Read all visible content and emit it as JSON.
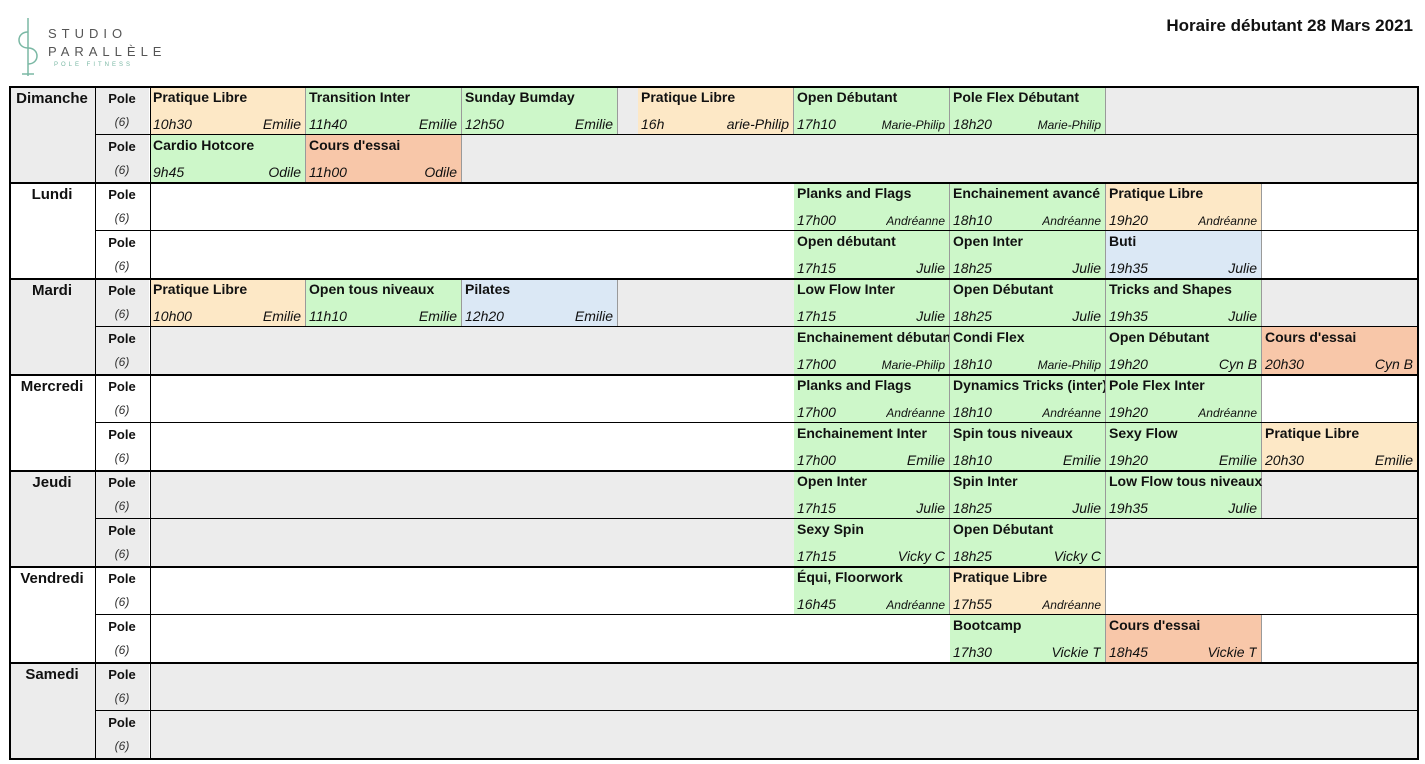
{
  "logo": {
    "line1": "STUDIO",
    "line2": "PARALLÈLE",
    "line3": "POLE FITNESS"
  },
  "title": "Horaire débutant 28 Mars 2021",
  "colors": {
    "green": "#cdf7c9",
    "orange": "#fde8c6",
    "salmon": "#f8c7a9",
    "blue": "#dbe8f5",
    "gray": "#ececec",
    "white": "#ffffff"
  },
  "pole_label": "Pole",
  "capacity": "(6)",
  "days": [
    {
      "name": "Dimanche",
      "rows": [
        {
          "bg": "gray",
          "classes": [
            {
              "col": 0,
              "name": "Pratique Libre",
              "time": "10h30",
              "instructor": "Emilie",
              "color": "orange"
            },
            {
              "col": 1,
              "name": "Transition Inter",
              "time": "11h40",
              "instructor": "Emilie",
              "color": "green"
            },
            {
              "col": 2,
              "name": "Sunday Bumday",
              "time": "12h50",
              "instructor": "Emilie",
              "color": "green"
            },
            {
              "col": 4,
              "name": "Pratique Libre",
              "time": "16h",
              "instructor": "arie-Philip",
              "color": "orange"
            },
            {
              "col": 5,
              "name": "Open Débutant",
              "time": "17h10",
              "instructor": "Marie-Philip",
              "color": "green",
              "small": true
            },
            {
              "col": 6,
              "name": "Pole Flex Débutant",
              "time": "18h20",
              "instructor": "Marie-Philip",
              "color": "green",
              "small": true
            }
          ]
        },
        {
          "bg": "gray",
          "classes": [
            {
              "col": 0,
              "name": "Cardio Hotcore",
              "time": "9h45",
              "instructor": "Odile",
              "color": "green"
            },
            {
              "col": 1,
              "name": "Cours d'essai",
              "time": "11h00",
              "instructor": "Odile",
              "color": "salmon"
            }
          ]
        }
      ]
    },
    {
      "name": "Lundi",
      "rows": [
        {
          "bg": "white",
          "classes": [
            {
              "col": 5,
              "name": "Planks and Flags",
              "time": "17h00",
              "instructor": "Andréanne",
              "color": "green",
              "small": true
            },
            {
              "col": 6,
              "name": "Enchainement avancé",
              "time": "18h10",
              "instructor": "Andréanne",
              "color": "green",
              "small": true
            },
            {
              "col": 7,
              "name": "Pratique Libre",
              "time": "19h20",
              "instructor": "Andréanne",
              "color": "orange",
              "small": true
            }
          ]
        },
        {
          "bg": "white",
          "classes": [
            {
              "col": 5,
              "name": "Open débutant",
              "time": "17h15",
              "instructor": "Julie",
              "color": "green"
            },
            {
              "col": 6,
              "name": "Open Inter",
              "time": "18h25",
              "instructor": "Julie",
              "color": "green"
            },
            {
              "col": 7,
              "name": "Buti",
              "time": "19h35",
              "instructor": "Julie",
              "color": "blue"
            }
          ]
        }
      ]
    },
    {
      "name": "Mardi",
      "rows": [
        {
          "bg": "gray",
          "classes": [
            {
              "col": 0,
              "name": "Pratique Libre",
              "time": "10h00",
              "instructor": "Emilie",
              "color": "orange"
            },
            {
              "col": 1,
              "name": "Open tous niveaux",
              "time": "11h10",
              "instructor": "Emilie",
              "color": "green"
            },
            {
              "col": 2,
              "name": "Pilates",
              "time": "12h20",
              "instructor": "Emilie",
              "color": "blue"
            },
            {
              "col": 5,
              "name": "Low Flow Inter",
              "time": "17h15",
              "instructor": "Julie",
              "color": "green"
            },
            {
              "col": 6,
              "name": "Open Débutant",
              "time": "18h25",
              "instructor": "Julie",
              "color": "green"
            },
            {
              "col": 7,
              "name": "Tricks and Shapes",
              "time": "19h35",
              "instructor": "Julie",
              "color": "green"
            }
          ]
        },
        {
          "bg": "gray",
          "classes": [
            {
              "col": 5,
              "name": "Enchainement débutant",
              "time": "17h00",
              "instructor": "Marie-Philip",
              "color": "green",
              "small": true
            },
            {
              "col": 6,
              "name": "Condi Flex",
              "time": "18h10",
              "instructor": "Marie-Philip",
              "color": "green",
              "small": true
            },
            {
              "col": 7,
              "name": "Open Débutant",
              "time": "19h20",
              "instructor": "Cyn B",
              "color": "green"
            },
            {
              "col": 8,
              "name": "Cours d'essai",
              "time": "20h30",
              "instructor": "Cyn B",
              "color": "salmon"
            }
          ]
        }
      ]
    },
    {
      "name": "Mercredi",
      "rows": [
        {
          "bg": "white",
          "classes": [
            {
              "col": 5,
              "name": "Planks and Flags",
              "time": "17h00",
              "instructor": "Andréanne",
              "color": "green",
              "small": true
            },
            {
              "col": 6,
              "name": "Dynamics Tricks (inter)",
              "time": "18h10",
              "instructor": "Andréanne",
              "color": "green",
              "small": true
            },
            {
              "col": 7,
              "name": "Pole Flex Inter",
              "time": "19h20",
              "instructor": "Andréanne",
              "color": "green",
              "small": true
            }
          ]
        },
        {
          "bg": "white",
          "classes": [
            {
              "col": 5,
              "name": "Enchainement Inter",
              "time": "17h00",
              "instructor": "Emilie",
              "color": "green"
            },
            {
              "col": 6,
              "name": "Spin tous niveaux",
              "time": "18h10",
              "instructor": "Emilie",
              "color": "green"
            },
            {
              "col": 7,
              "name": "Sexy Flow",
              "time": "19h20",
              "instructor": "Emilie",
              "color": "green"
            },
            {
              "col": 8,
              "name": "Pratique Libre",
              "time": "20h30",
              "instructor": "Emilie",
              "color": "orange"
            }
          ]
        }
      ]
    },
    {
      "name": "Jeudi",
      "rows": [
        {
          "bg": "gray",
          "classes": [
            {
              "col": 5,
              "name": "Open Inter",
              "time": "17h15",
              "instructor": "Julie",
              "color": "green"
            },
            {
              "col": 6,
              "name": "Spin Inter",
              "time": "18h25",
              "instructor": "Julie",
              "color": "green"
            },
            {
              "col": 7,
              "name": "Low Flow tous niveaux",
              "time": "19h35",
              "instructor": "Julie",
              "color": "green",
              "overflow": true
            }
          ]
        },
        {
          "bg": "gray",
          "classes": [
            {
              "col": 5,
              "name": "Sexy Spin",
              "time": "17h15",
              "instructor": "Vicky C",
              "color": "green"
            },
            {
              "col": 6,
              "name": "Open Débutant",
              "time": "18h25",
              "instructor": "Vicky C",
              "color": "green"
            }
          ]
        }
      ]
    },
    {
      "name": "Vendredi",
      "rows": [
        {
          "bg": "white",
          "classes": [
            {
              "col": 5,
              "name": "Équi, Floorwork",
              "time": "16h45",
              "instructor": "Andréanne",
              "color": "green",
              "small": true
            },
            {
              "col": 6,
              "name": "Pratique Libre",
              "time": "17h55",
              "instructor": "Andréanne",
              "color": "orange",
              "small": true
            }
          ]
        },
        {
          "bg": "white",
          "classes": [
            {
              "col": 6,
              "name": "Bootcamp",
              "time": "17h30",
              "instructor": "Vickie T",
              "color": "green"
            },
            {
              "col": 7,
              "name": "Cours d'essai",
              "time": "18h45",
              "instructor": "Vickie T",
              "color": "salmon"
            }
          ]
        }
      ]
    },
    {
      "name": "Samedi",
      "rows": [
        {
          "bg": "gray",
          "classes": []
        },
        {
          "bg": "gray",
          "classes": []
        }
      ]
    }
  ]
}
